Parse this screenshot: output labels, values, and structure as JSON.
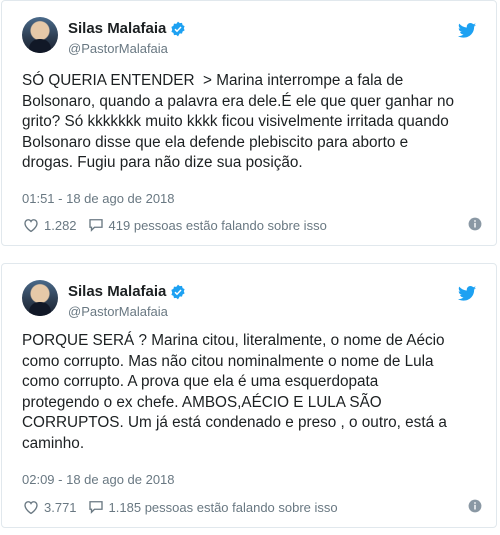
{
  "tweets": [
    {
      "author": {
        "name": "Silas Malafaia",
        "handle": "@PastorMalafaia"
      },
      "text": "SÓ QUERIA ENTENDER  > Marina interrompe a fala de\nBolsonaro, quando a palavra era dele.É ele que quer ganhar no\ngrito? Só kkkkkkk muito kkkk ficou visivelmente irritada quando\nBolsonaro disse que ela defende plebiscito para aborto e\ndrogas. Fugiu para não dize sua posição.",
      "timestamp": "01:51 - 18 de ago de 2018",
      "likes": "1.282",
      "conversation": "419 pessoas estão falando sobre isso"
    },
    {
      "author": {
        "name": "Silas Malafaia",
        "handle": "@PastorMalafaia"
      },
      "text": "PORQUE SERÁ ? Marina citou, literalmente, o nome de Aécio\ncomo corrupto. Mas não citou nominalmente o nome de Lula\ncomo corrupto. A prova que ela é uma esquerdopata\nprotegendo o ex chefe. AMBOS,AÉCIO E LULA SÃO\nCORRUPTOS. Um já está condenado e preso , o outro, está a\ncaminho.",
      "timestamp": "02:09 - 18 de ago de 2018",
      "likes": "3.771",
      "conversation": "1.185 pessoas estão falando sobre isso"
    }
  ],
  "icons": {
    "verified": "verified-badge-icon",
    "twitter": "twitter-bird-icon",
    "like": "heart-icon",
    "reply": "speech-bubble-icon",
    "info": "info-icon"
  },
  "colors": {
    "twitter_blue": "#1da1f2",
    "muted": "#697882",
    "border": "#e1e8ed"
  }
}
